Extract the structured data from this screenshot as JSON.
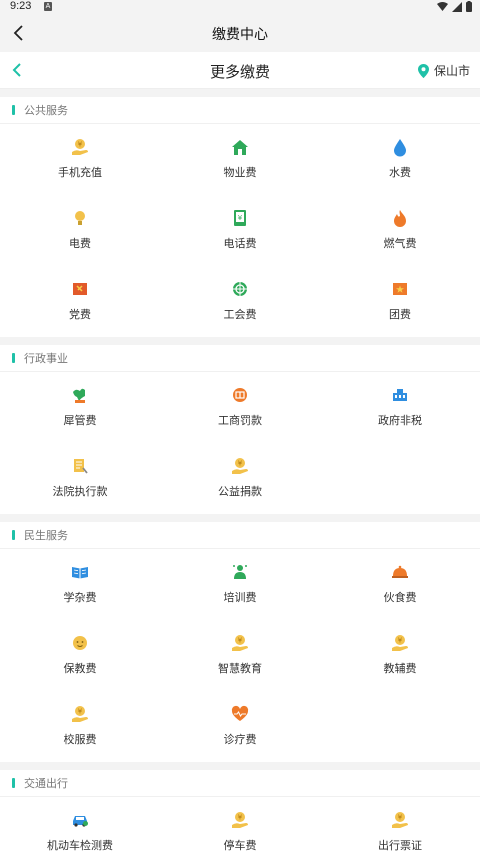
{
  "status": {
    "time": "9:23",
    "notif": "A"
  },
  "app_bar": {
    "title": "缴费中心"
  },
  "sub_bar": {
    "title": "更多缴费",
    "city": "保山市"
  },
  "sections": [
    {
      "title": "公共服务",
      "items": [
        {
          "label": "手机充值",
          "icon": "coin-hand-icon"
        },
        {
          "label": "物业费",
          "icon": "house-icon"
        },
        {
          "label": "水费",
          "icon": "water-drop-icon"
        },
        {
          "label": "电费",
          "icon": "lightbulb-icon"
        },
        {
          "label": "电话费",
          "icon": "phone-bill-icon"
        },
        {
          "label": "燃气费",
          "icon": "flame-icon"
        },
        {
          "label": "党费",
          "icon": "party-flag-icon"
        },
        {
          "label": "工会费",
          "icon": "union-badge-icon"
        },
        {
          "label": "团费",
          "icon": "star-flag-icon"
        }
      ]
    },
    {
      "title": "行政事业",
      "items": [
        {
          "label": "犀管费",
          "icon": "map-icon"
        },
        {
          "label": "工商罚款",
          "icon": "fine-stamp-icon"
        },
        {
          "label": "政府非税",
          "icon": "government-building-icon"
        },
        {
          "label": "法院执行款",
          "icon": "document-pen-icon"
        },
        {
          "label": "公益捐款",
          "icon": "coin-hand-icon"
        }
      ]
    },
    {
      "title": "民生服务",
      "items": [
        {
          "label": "学杂费",
          "icon": "book-icon"
        },
        {
          "label": "培训费",
          "icon": "trainer-icon"
        },
        {
          "label": "伙食费",
          "icon": "food-dome-icon"
        },
        {
          "label": "保教费",
          "icon": "baby-face-icon"
        },
        {
          "label": "智慧教育",
          "icon": "coin-hand-icon"
        },
        {
          "label": "教辅费",
          "icon": "coin-hand-icon"
        },
        {
          "label": "校服费",
          "icon": "coin-hand-icon"
        },
        {
          "label": "诊疗费",
          "icon": "heart-pulse-icon"
        }
      ]
    },
    {
      "title": "交通出行",
      "items": [
        {
          "label": "机动车检测费",
          "icon": "car-icon"
        },
        {
          "label": "停车费",
          "icon": "coin-hand-icon"
        },
        {
          "label": "出行票证",
          "icon": "coin-hand-icon"
        }
      ]
    }
  ],
  "colors": {
    "accent": "#1fc1a8",
    "orange": "#ee7a2a",
    "yellow": "#f2c14a",
    "green": "#2fa95a",
    "blue": "#2f8ee0"
  }
}
